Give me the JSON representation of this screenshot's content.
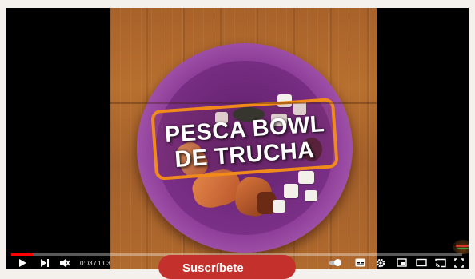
{
  "video": {
    "overlay_title_line1": "PESCA BOWL",
    "overlay_title_line2": "DE TRUCHA"
  },
  "player": {
    "current_time": "0:03",
    "time_separator": " / ",
    "duration": "1:03",
    "progress_fraction": 0.048
  },
  "subscribe": {
    "label": "Suscríbete"
  },
  "icons": {
    "play": "play-icon",
    "next": "next-icon",
    "mute": "volume-muted-icon",
    "autoplay": "autoplay-toggle",
    "subtitles": "subtitles-icon",
    "settings": "gear-icon",
    "miniplayer": "miniplayer-icon",
    "theater": "theater-icon",
    "cast": "cast-icon",
    "fullscreen": "fullscreen-icon"
  },
  "colors": {
    "progress": "#ff0000",
    "subscribe_bg": "#c4302b",
    "title_frame": "#f08a1a",
    "bowl": "#8a3a95"
  }
}
